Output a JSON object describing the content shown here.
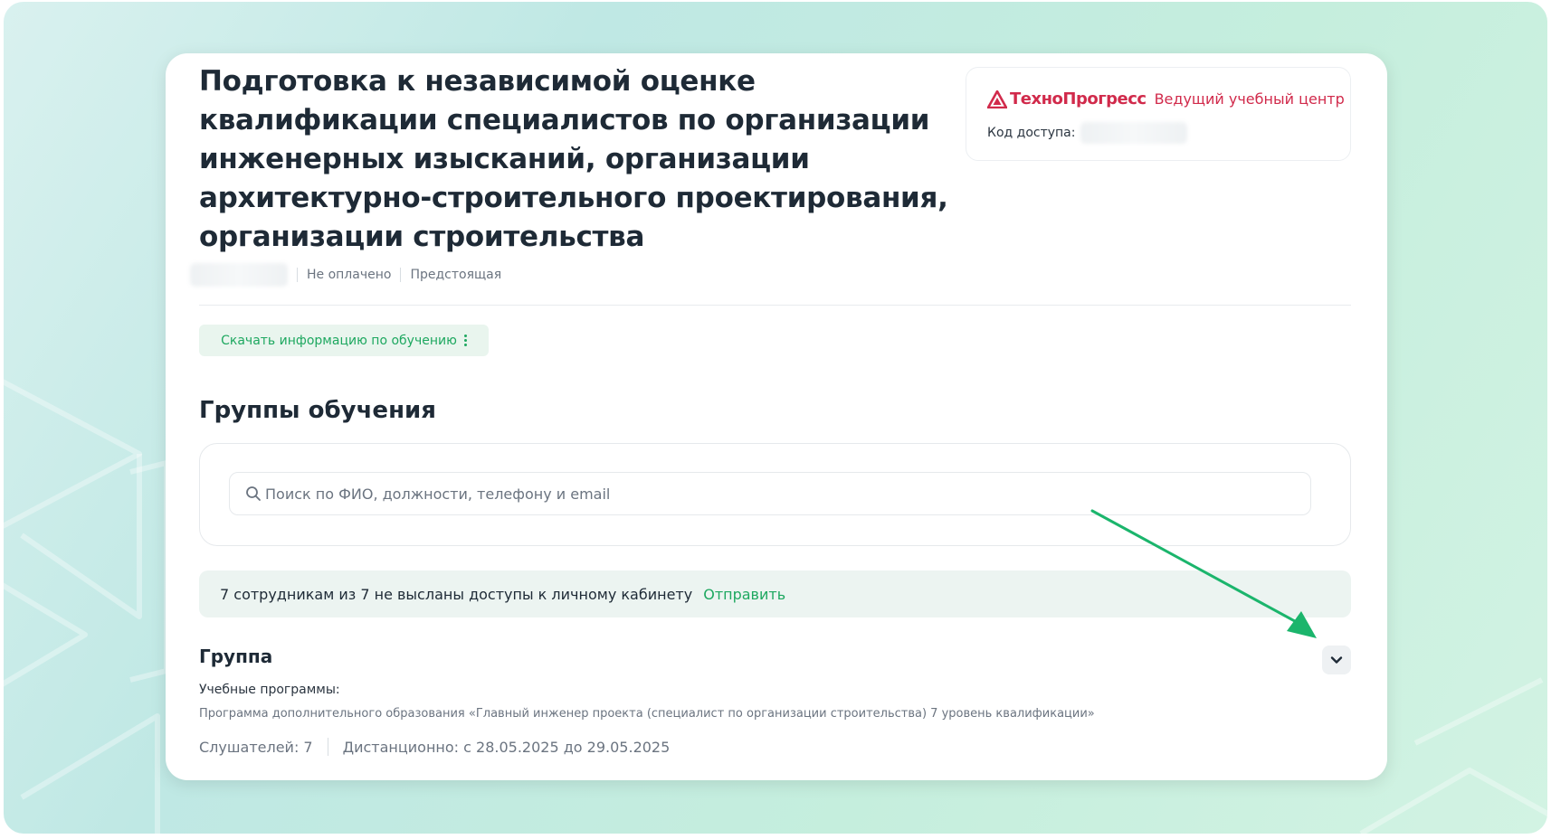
{
  "course": {
    "title": "Подготовка к независимой оценке квалификации специалистов по организации инженерных изысканий, организации архитектурно-строительного проектирования, организации строительства",
    "payment_status": "Не оплачено",
    "schedule_status": "Предстоящая"
  },
  "brand": {
    "name": "ТехноПрогресс",
    "tagline": "Ведущий учебный центр",
    "access_label": "Код доступа:",
    "color": "#d12a4b"
  },
  "actions": {
    "download_label": "Скачать информацию по обучению"
  },
  "groups_section": {
    "title": "Группы обучения",
    "search_placeholder": "Поиск по ФИО, должности, телефону и email"
  },
  "notice": {
    "text": "7 сотрудникам из 7 не высланы доступы к личному кабинету",
    "action": "Отправить"
  },
  "group": {
    "title": "Группа",
    "programs_label": "Учебные программы:",
    "program": "Программа дополнительного образования «Главный инженер проекта (специалист по организации строительства) 7 уровень квалификации»",
    "listeners": "Слушателей: 7",
    "schedule": "Дистанционно: с 28.05.2025 до 29.05.2025"
  },
  "icons": {
    "search": "search-icon",
    "expand": "chevron-down-icon",
    "more": "more-vertical-icon",
    "brand_logo": "brand-logo-icon"
  },
  "colors": {
    "accent": "#1ea860",
    "text": "#1e2a36"
  }
}
